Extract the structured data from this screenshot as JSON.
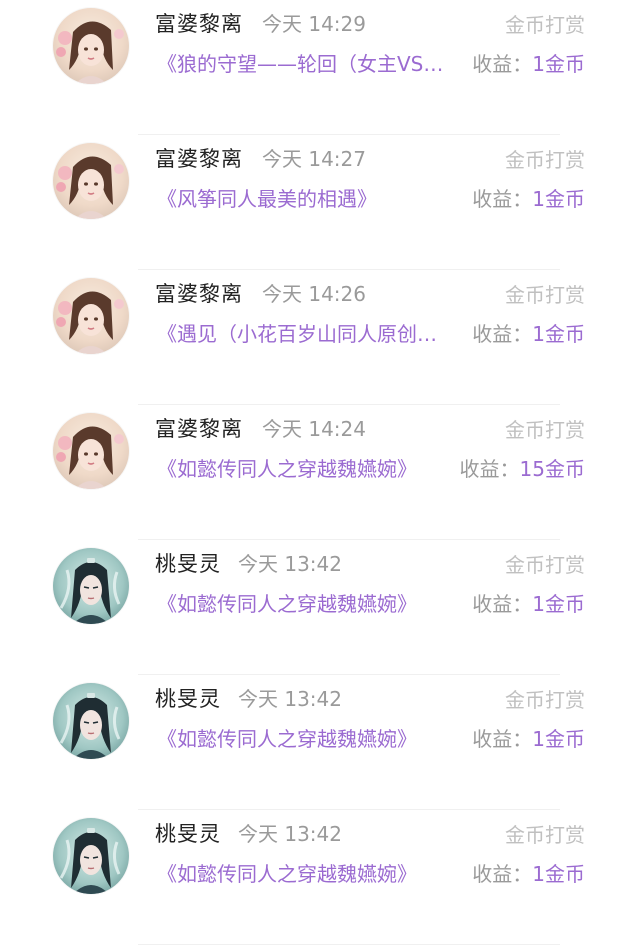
{
  "accent": "#9b6bd1",
  "records": [
    {
      "user": "富婆黎离",
      "time": "今天 14:29",
      "type": "金币打赏",
      "title": "《狼的守望——轮回（女主VS…",
      "income_label": "收益：",
      "income_value": "1金币",
      "avatar": "female-avatar-icon"
    },
    {
      "user": "富婆黎离",
      "time": "今天 14:27",
      "type": "金币打赏",
      "title": "《风筝同人最美的相遇》",
      "income_label": "收益：",
      "income_value": "1金币",
      "avatar": "female-avatar-icon"
    },
    {
      "user": "富婆黎离",
      "time": "今天 14:26",
      "type": "金币打赏",
      "title": "《遇见（小花百岁山同人原创…",
      "income_label": "收益：",
      "income_value": "1金币",
      "avatar": "female-avatar-icon"
    },
    {
      "user": "富婆黎离",
      "time": "今天 14:24",
      "type": "金币打赏",
      "title": "《如懿传同人之穿越魏嬿婉》",
      "income_label": "收益：",
      "income_value": "15金币",
      "avatar": "female-avatar-icon"
    },
    {
      "user": "桃旻灵",
      "time": "今天 13:42",
      "type": "金币打赏",
      "title": "《如懿传同人之穿越魏嬿婉》",
      "income_label": "收益：",
      "income_value": "1金币",
      "avatar": "male-avatar-icon"
    },
    {
      "user": "桃旻灵",
      "time": "今天 13:42",
      "type": "金币打赏",
      "title": "《如懿传同人之穿越魏嬿婉》",
      "income_label": "收益：",
      "income_value": "1金币",
      "avatar": "male-avatar-icon"
    },
    {
      "user": "桃旻灵",
      "time": "今天 13:42",
      "type": "金币打赏",
      "title": "《如懿传同人之穿越魏嬿婉》",
      "income_label": "收益：",
      "income_value": "1金币",
      "avatar": "male-avatar-icon"
    }
  ]
}
